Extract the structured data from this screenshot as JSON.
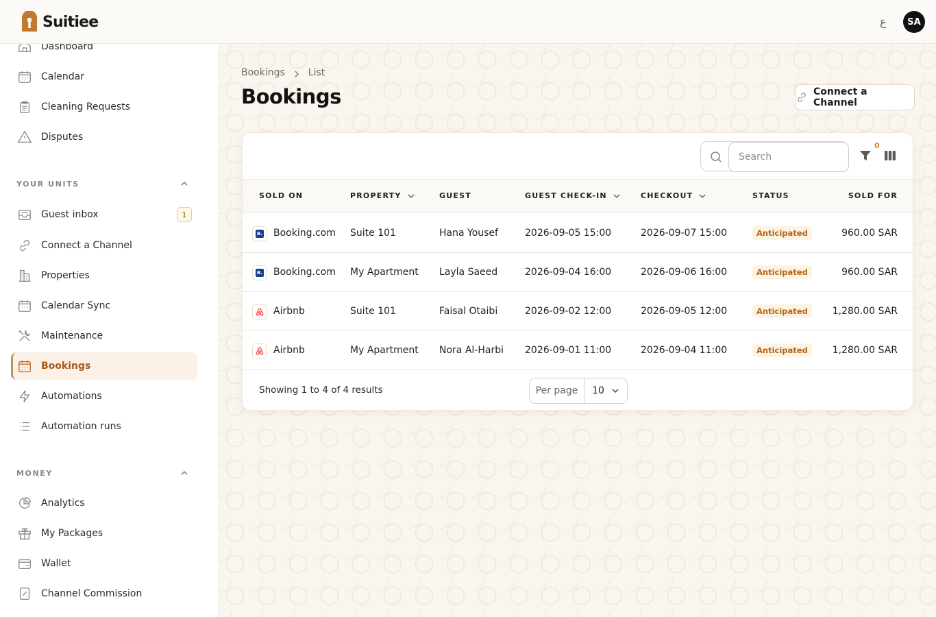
{
  "app": {
    "name": "Suitiee",
    "lang_toggle": "ع",
    "avatar_initials": "SA",
    "accent": "#b5641f"
  },
  "sidebar": {
    "top_items": [
      {
        "label": "Dashboard",
        "icon": "home-icon"
      },
      {
        "label": "Calendar",
        "icon": "calendar-icon"
      },
      {
        "label": "Cleaning Requests",
        "icon": "clipboard-icon"
      },
      {
        "label": "Disputes",
        "icon": "warning-icon"
      }
    ],
    "units_section": "YOUR UNITS",
    "unit_items": [
      {
        "label": "Guest inbox",
        "icon": "inbox-icon",
        "badge": "1"
      },
      {
        "label": "Connect a Channel",
        "icon": "link-icon"
      },
      {
        "label": "Properties",
        "icon": "building-icon"
      },
      {
        "label": "Calendar Sync",
        "icon": "calendar-sync-icon"
      },
      {
        "label": "Maintenance",
        "icon": "tools-icon"
      },
      {
        "label": "Bookings",
        "icon": "bookings-icon",
        "active": true
      },
      {
        "label": "Automations",
        "icon": "bolt-icon"
      },
      {
        "label": "Automation runs",
        "icon": "list-icon"
      }
    ],
    "money_section": "MONEY",
    "money_items": [
      {
        "label": "Analytics",
        "icon": "pie-chart-icon"
      },
      {
        "label": "My Packages",
        "icon": "gift-icon"
      },
      {
        "label": "Wallet",
        "icon": "wallet-icon"
      },
      {
        "label": "Channel Commission",
        "icon": "percent-icon"
      }
    ]
  },
  "breadcrumb": {
    "root": "Bookings",
    "current": "List"
  },
  "page": {
    "title": "Bookings",
    "connect_button": "Connect a Channel"
  },
  "toolbar": {
    "search_placeholder": "Search",
    "filter_count": "0"
  },
  "table": {
    "columns": [
      "SOLD ON",
      "PROPERTY",
      "GUEST",
      "GUEST CHECK-IN",
      "CHECKOUT",
      "STATUS",
      "SOLD FOR"
    ],
    "rows": [
      {
        "channel": "Booking.com",
        "channel_type": "booking",
        "property": "Suite 101",
        "guest": "Hana Yousef",
        "checkin": "2026-09-05 15:00",
        "checkout": "2026-09-07 15:00",
        "status": "Anticipated",
        "amount": "960.00 SAR"
      },
      {
        "channel": "Booking.com",
        "channel_type": "booking",
        "property": "My Apartment",
        "guest": "Layla Saeed",
        "checkin": "2026-09-04 16:00",
        "checkout": "2026-09-06 16:00",
        "status": "Anticipated",
        "amount": "960.00 SAR"
      },
      {
        "channel": "Airbnb",
        "channel_type": "airbnb",
        "property": "Suite 101",
        "guest": "Faisal Otaibi",
        "checkin": "2026-09-02 12:00",
        "checkout": "2026-09-05 12:00",
        "status": "Anticipated",
        "amount": "1,280.00 SAR"
      },
      {
        "channel": "Airbnb",
        "channel_type": "airbnb",
        "property": "My Apartment",
        "guest": "Nora Al-Harbi",
        "checkin": "2026-09-01 11:00",
        "checkout": "2026-09-04 11:00",
        "status": "Anticipated",
        "amount": "1,280.00 SAR"
      }
    ]
  },
  "footer": {
    "showing": "Showing 1 to 4 of 4 results",
    "per_page_label": "Per page",
    "per_page_value": "10"
  }
}
